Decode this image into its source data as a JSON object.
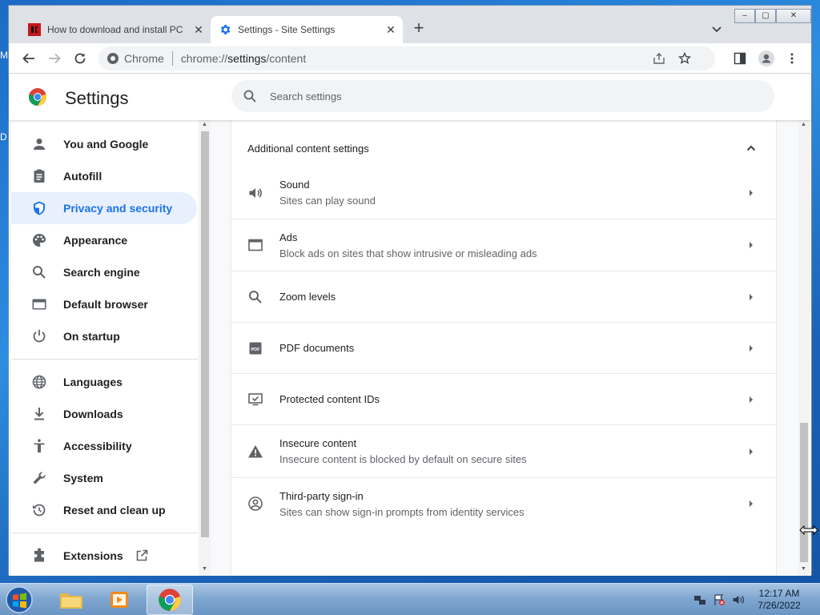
{
  "desktop": {
    "label_1": "M",
    "label_2": "D"
  },
  "tabs": [
    {
      "title": "How to download and install PC",
      "close": "✕"
    },
    {
      "title": "Settings - Site Settings",
      "close": "✕"
    }
  ],
  "newtab": "+",
  "window_controls": {
    "minimize": "–",
    "maximize": "▢",
    "close": "✕"
  },
  "omnibox": {
    "scheme": "Chrome",
    "url_prefix": "chrome://",
    "url_path": "settings",
    "url_suffix": "/content"
  },
  "settings": {
    "title": "Settings",
    "search_placeholder": "Search settings",
    "nav": [
      {
        "label": "You and Google",
        "icon": "person-icon"
      },
      {
        "label": "Autofill",
        "icon": "clipboard-icon"
      },
      {
        "label": "Privacy and security",
        "icon": "shield-icon",
        "selected": true
      },
      {
        "label": "Appearance",
        "icon": "palette-icon"
      },
      {
        "label": "Search engine",
        "icon": "search-icon"
      },
      {
        "label": "Default browser",
        "icon": "browser-icon"
      },
      {
        "label": "On startup",
        "icon": "power-icon"
      },
      {
        "label": "Languages",
        "icon": "globe-icon"
      },
      {
        "label": "Downloads",
        "icon": "download-icon"
      },
      {
        "label": "Accessibility",
        "icon": "accessibility-icon"
      },
      {
        "label": "System",
        "icon": "wrench-icon"
      },
      {
        "label": "Reset and clean up",
        "icon": "restore-icon"
      },
      {
        "label": "Extensions",
        "icon": "puzzle-icon"
      }
    ],
    "section_title": "Additional content settings",
    "rows": [
      {
        "label": "Sound",
        "sub": "Sites can play sound",
        "icon": "speaker-icon"
      },
      {
        "label": "Ads",
        "sub": "Block ads on sites that show intrusive or misleading ads",
        "icon": "ads-window-icon"
      },
      {
        "label": "Zoom levels",
        "sub": "",
        "icon": "zoom-icon"
      },
      {
        "label": "PDF documents",
        "sub": "",
        "icon": "pdf-icon"
      },
      {
        "label": "Protected content IDs",
        "sub": "",
        "icon": "protected-content-icon"
      },
      {
        "label": "Insecure content",
        "sub": "Insecure content is blocked by default on secure sites",
        "icon": "warning-icon"
      },
      {
        "label": "Third-party sign-in",
        "sub": "Sites can show sign-in prompts from identity services",
        "icon": "account-circle-icon"
      }
    ]
  },
  "taskbar": {
    "time": "12:17 AM",
    "date": "7/26/2022"
  },
  "colors": {
    "accent": "#1a73e8",
    "selected_bg": "#e8f0fe",
    "icon": "#5f6368"
  }
}
